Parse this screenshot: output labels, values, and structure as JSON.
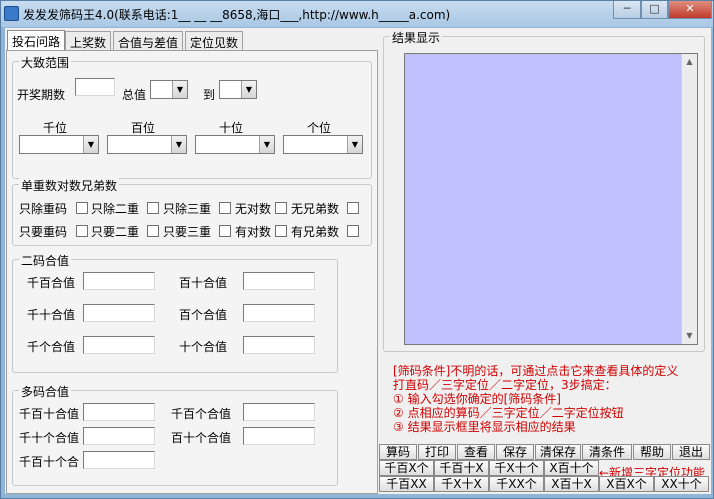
{
  "window": {
    "title": "发发发筛码王4.0(联系电话:1__ __ __8658,海口___,http://www.h_____a.com)",
    "min_glyph": "─",
    "max_glyph": "□",
    "close_glyph": "✕"
  },
  "tabs": [
    "投石问路",
    "上奖数",
    "合值与差值",
    "定位见数"
  ],
  "range": {
    "legend": "大致范围",
    "periods_label": "开奖期数",
    "total_label": "总值",
    "to_label": "到",
    "positions": [
      "千位",
      "百位",
      "十位",
      "个位"
    ]
  },
  "repeats": {
    "legend": "单重数对数兄弟数",
    "row1": [
      "只除重码",
      "只除二重",
      "只除三重",
      "无对数",
      "无兄弟数"
    ],
    "row2": [
      "只要重码",
      "只要二重",
      "只要三重",
      "有对数",
      "有兄弟数"
    ]
  },
  "two_code": {
    "legend": "二码合值",
    "labels": [
      "千百合值",
      "百十合值",
      "千十合值",
      "百个合值",
      "千个合值",
      "十个合值"
    ]
  },
  "multi_code": {
    "legend": "多码合值",
    "labels": [
      "千百十合值",
      "千百个合值",
      "千十个合值",
      "百十个合值",
      "千百十个合"
    ]
  },
  "results": {
    "legend": "结果显示"
  },
  "help_lines": [
    "[筛码条件]不明的话，可通过点击它来查看具体的定义",
    "打直码／三字定位／二字定位，3步搞定：",
    "① 输入勾选你确定的[筛码条件]",
    "② 点相应的算码／三字定位／二字定位按钮",
    "③ 结果显示框里将显示相应的结果"
  ],
  "actions": [
    "算码",
    "打印",
    "查看",
    "保存",
    "清保存",
    "清条件",
    "帮助",
    "退出"
  ],
  "three_pos_row1": [
    "千百X个",
    "千百十X",
    "千X十个",
    "X百十个"
  ],
  "three_pos_row2": [
    "千百XX",
    "千X十X",
    "千XX个",
    "X百十X",
    "X百X个",
    "XX十个"
  ],
  "new_feature": "←新增三字定位功能"
}
